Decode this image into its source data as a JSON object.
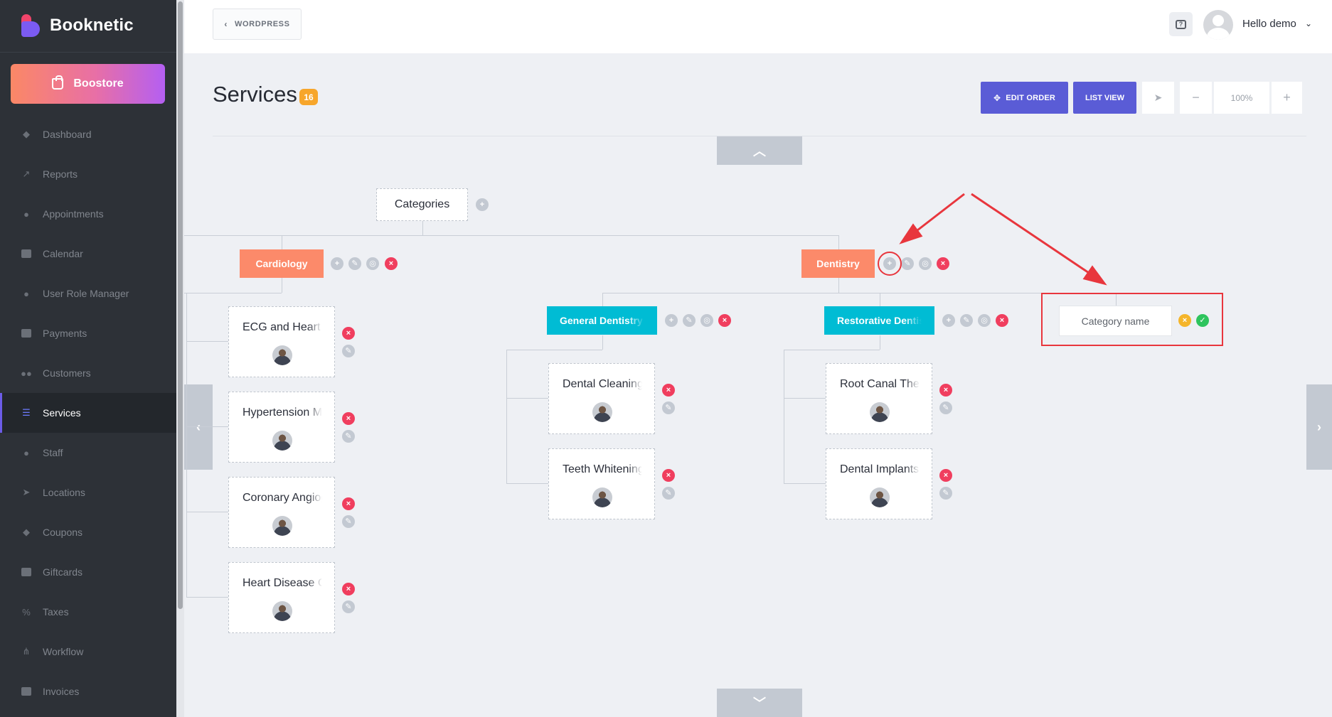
{
  "app": {
    "name": "Booknetic"
  },
  "sidebar": {
    "boostore_label": "Boostore",
    "items": [
      {
        "label": "Dashboard",
        "icon": "dashboard-icon"
      },
      {
        "label": "Reports",
        "icon": "chart-line-icon"
      },
      {
        "label": "Appointments",
        "icon": "clock-icon"
      },
      {
        "label": "Calendar",
        "icon": "calendar-icon"
      },
      {
        "label": "User Role Manager",
        "icon": "user-plus-icon"
      },
      {
        "label": "Payments",
        "icon": "wallet-icon"
      },
      {
        "label": "Customers",
        "icon": "users-icon"
      },
      {
        "label": "Services",
        "icon": "list-icon",
        "active": true
      },
      {
        "label": "Staff",
        "icon": "user-icon"
      },
      {
        "label": "Locations",
        "icon": "location-arrow-icon"
      },
      {
        "label": "Coupons",
        "icon": "tag-icon"
      },
      {
        "label": "Giftcards",
        "icon": "gift-icon"
      },
      {
        "label": "Taxes",
        "icon": "percent-icon"
      },
      {
        "label": "Workflow",
        "icon": "workflow-icon"
      },
      {
        "label": "Invoices",
        "icon": "invoice-icon"
      }
    ]
  },
  "header": {
    "back_label": "WORDPRESS",
    "greeting": "Hello demo"
  },
  "page": {
    "title": "Services",
    "count": "16",
    "edit_order_label": "EDIT ORDER",
    "list_view_label": "LIST VIEW",
    "zoom": "100%"
  },
  "tree": {
    "root_label": "Categories",
    "categories": {
      "cardiology": "Cardiology",
      "dentistry": "Dentistry",
      "general_dentistry": "General Dentistry",
      "restorative_dentistry": "Restorative Dentistry"
    },
    "services": {
      "cardiology": [
        "ECG and Heart Monitoring",
        "Hypertension Management",
        "Coronary Angiography",
        "Heart Disease Consultation"
      ],
      "general_dentistry": [
        "Dental Cleaning",
        "Teeth Whitening"
      ],
      "restorative_dentistry": [
        "Root Canal Therapy",
        "Dental Implants"
      ]
    },
    "new_category_placeholder": "Category name"
  },
  "colors": {
    "accent": "#5a5cd6",
    "category_orange": "#fc8a6a",
    "subcategory_teal": "#00bcd4",
    "delete_red": "#f03e5e",
    "annotation_red": "#e8363d"
  }
}
